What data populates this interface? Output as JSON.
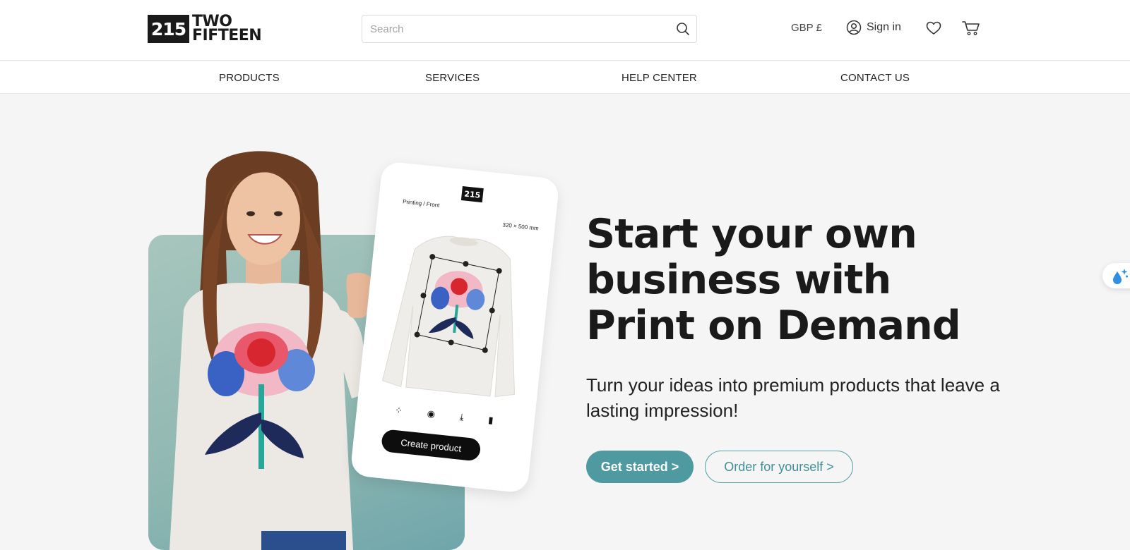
{
  "brand": {
    "mark": "215",
    "line1": "TWO",
    "line2": "FIFTEEN"
  },
  "search": {
    "placeholder": "Search",
    "value": ""
  },
  "header": {
    "currency": "GBP £",
    "signin": "Sign in"
  },
  "nav": {
    "items": [
      "PRODUCTS",
      "SERVICES",
      "HELP CENTER",
      "CONTACT US"
    ]
  },
  "mockup": {
    "logo": "215",
    "mode": "Printing / Front",
    "size": "320 × 500 mm",
    "cta": "Create product"
  },
  "hero": {
    "headline_1": "Start your own",
    "headline_2": "business with",
    "headline_3": "Print on Demand",
    "subline": "Turn your ideas into premium products that leave a lasting impression!",
    "cta_primary": "Get started >",
    "cta_secondary": "Order for yourself >"
  },
  "colors": {
    "accent": "#4f9aa0",
    "panel": "#9cc2ba",
    "text": "#1a1a1a"
  }
}
